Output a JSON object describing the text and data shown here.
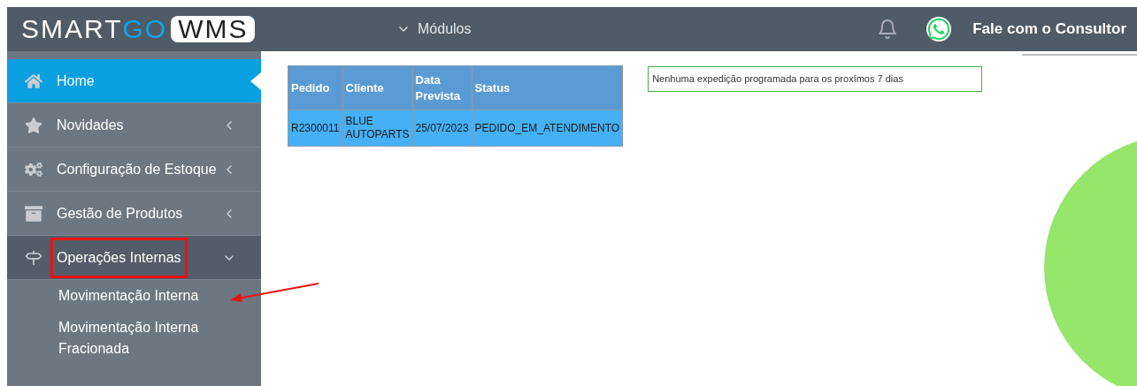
{
  "header": {
    "logo": {
      "part_1": "SMART",
      "part_2": "GO",
      "part_3": "WMS"
    },
    "modules_menu": "Módulos",
    "contact": "Fale com o Consultor"
  },
  "sidebar": {
    "items": [
      {
        "label": "Home",
        "selected": true
      },
      {
        "label": "Novidades",
        "selected": false,
        "expanded": false
      },
      {
        "label": "Configuração de Estoque",
        "selected": false,
        "expanded": false
      },
      {
        "label": "Gestão de Produtos",
        "selected": false,
        "expanded": false
      },
      {
        "label": "Operações Internas",
        "selected": false,
        "expanded": true,
        "highlighted": true,
        "children": [
          {
            "label": "Movimentação Interna",
            "pointed": true
          },
          {
            "label": "Movimentação Interna Fracionada",
            "pointed": false
          }
        ]
      }
    ]
  },
  "orders_table": {
    "columns": [
      "Pedido",
      "Cliente",
      "Data Prevista",
      "Status"
    ],
    "rows": [
      [
        "R2300011",
        "BLUE AUTOPARTS",
        "25/07/2023",
        "PEDIDO_EM_ATENDIMENTO"
      ]
    ]
  },
  "shipments_notice": "Nenhuma expedição programada para os proxímos 7 dias"
}
